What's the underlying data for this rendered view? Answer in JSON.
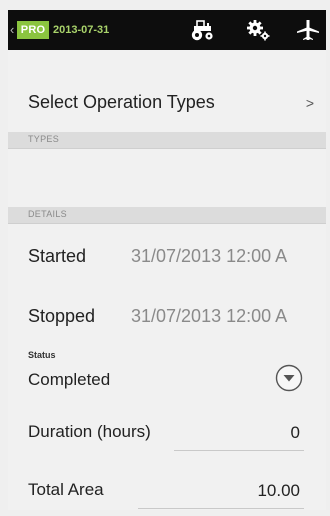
{
  "action_bar": {
    "pro_label": "PRO",
    "date": "2013-07-31",
    "back_glyph": "‹",
    "icons": [
      "tractor-icon",
      "gear-icon",
      "plane-icon"
    ]
  },
  "operation": {
    "select_label": "Select Operation Types",
    "chevron": ">"
  },
  "sections": {
    "types": "TYPES",
    "details": "DETAILS"
  },
  "fields": {
    "started_label": "Started",
    "started_value": "31/07/2013 12:00 A",
    "stopped_label": "Stopped",
    "stopped_value": "31/07/2013 12:00 A",
    "status_label": "Status",
    "status_value": "Completed",
    "duration_label": "Duration (hours)",
    "duration_value": "0",
    "area_label": "Total Area",
    "area_value": "10.00"
  },
  "colors": {
    "action_bar_bg": "#0d0d0d",
    "brand_green": "#8bc43f",
    "date_green": "#a9d36b",
    "section_bg": "#dcdcdc"
  }
}
